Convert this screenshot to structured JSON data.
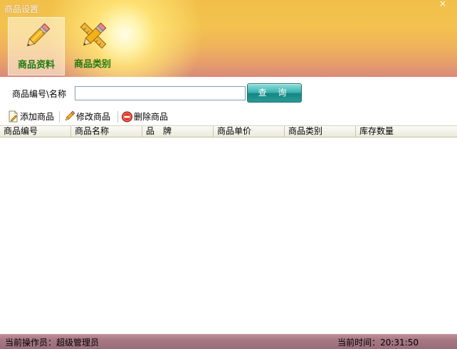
{
  "window": {
    "title": "商品设置",
    "close_glyph": "×"
  },
  "modules": [
    {
      "label": "商品资料",
      "icon": "pencil-icon",
      "active": true
    },
    {
      "label": "商品类别",
      "icon": "pencil-ruler-icon",
      "active": false
    }
  ],
  "search": {
    "label": "商品编号\\名称",
    "value": "",
    "placeholder": "",
    "button_label": "查 询"
  },
  "toolbar": {
    "add_label": "添加商品",
    "edit_label": "修改商品",
    "delete_label": "删除商品"
  },
  "table": {
    "columns": [
      "商品编号",
      "商品名称",
      "品　牌",
      "商品单价",
      "商品类别",
      "库存数量"
    ],
    "rows": []
  },
  "status": {
    "operator": "当前操作员：超级管理员",
    "time": "当前时间：20:31:50"
  },
  "colors": {
    "module_label": "#1f7a10",
    "search_button": "#138784",
    "status_bar": "#a67884"
  }
}
